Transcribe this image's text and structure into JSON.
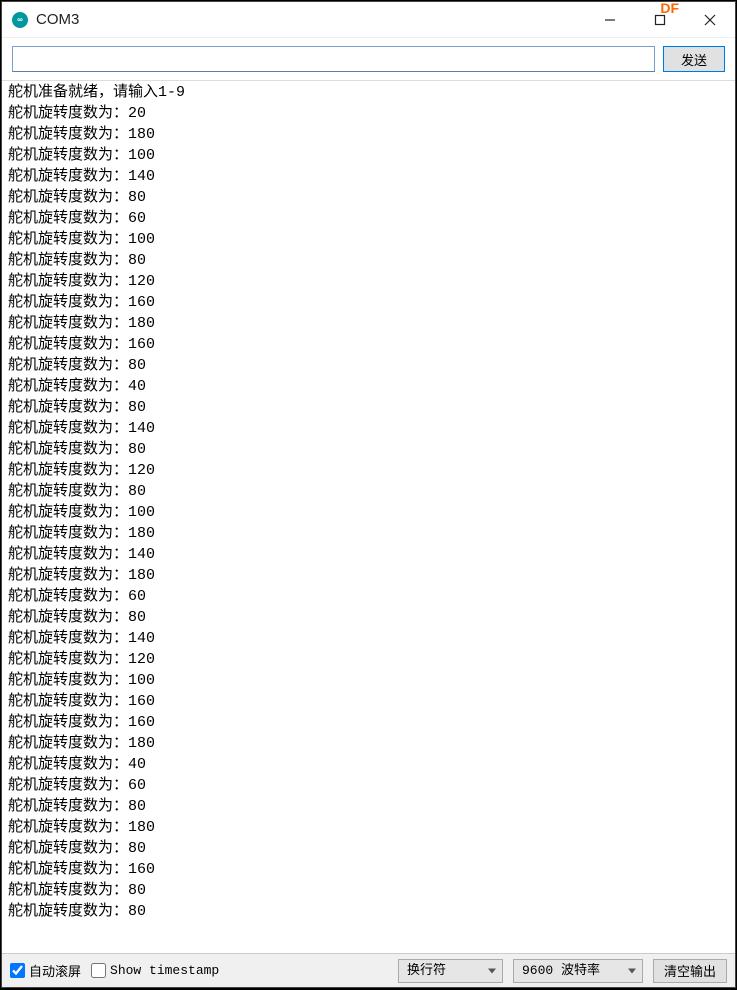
{
  "window": {
    "title": "COM3"
  },
  "toolbar": {
    "send_label": "发送",
    "input_value": ""
  },
  "console": {
    "header_line": "舵机准备就绪，请输入1-9",
    "log_prefix": "舵机旋转度数为：",
    "values": [
      20,
      180,
      100,
      140,
      80,
      60,
      100,
      80,
      120,
      160,
      180,
      160,
      80,
      40,
      80,
      140,
      80,
      120,
      80,
      100,
      180,
      140,
      180,
      60,
      80,
      140,
      120,
      100,
      160,
      160,
      180,
      40,
      60,
      80,
      180,
      80,
      160,
      80,
      80
    ]
  },
  "bottombar": {
    "autoscroll_label": "自动滚屏",
    "autoscroll_checked": true,
    "timestamp_label": "Show timestamp",
    "timestamp_checked": false,
    "line_ending_selected": "换行符",
    "baud_selected": "9600 波特率",
    "clear_label": "清空输出"
  },
  "overlay": {
    "df_text": "DF"
  }
}
